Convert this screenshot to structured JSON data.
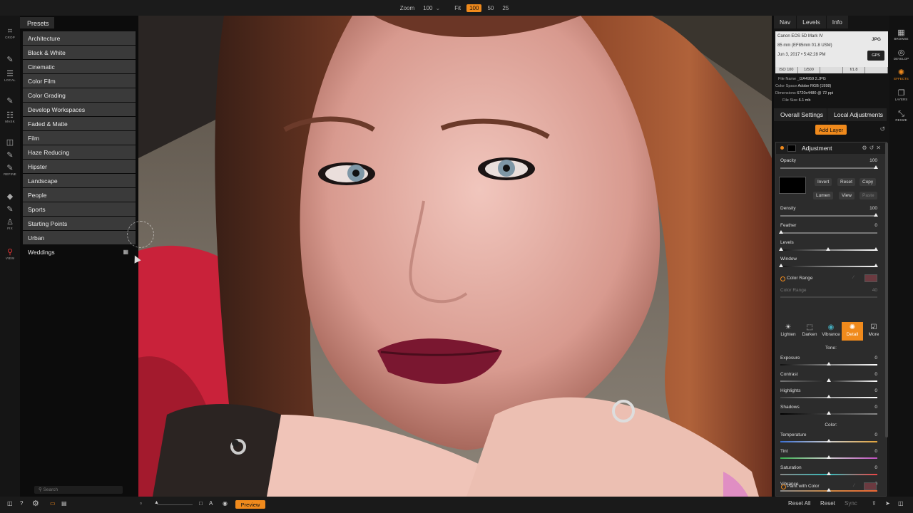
{
  "topbar": {
    "zoom_label": "Zoom",
    "zoom_value": "100",
    "zoom_buttons": [
      "Fit",
      "100",
      "50",
      "25"
    ],
    "active_zoom": "100"
  },
  "tools_left": [
    {
      "icon": "crop-icon",
      "label": "CROP"
    },
    {
      "icon": "brush-icon",
      "label": ""
    },
    {
      "icon": "local-icon",
      "label": "LOCAL"
    },
    {
      "icon": "mask-brush-icon",
      "label": ""
    },
    {
      "icon": "mask-icon",
      "label": "MASK"
    },
    {
      "icon": "refine-icon",
      "label": ""
    },
    {
      "icon": "refine-brush-icon",
      "label": ""
    },
    {
      "icon": "refine-pen-icon",
      "label": "REFINE"
    },
    {
      "icon": "fix-drop-icon",
      "label": ""
    },
    {
      "icon": "fix-pen-icon",
      "label": ""
    },
    {
      "icon": "fix-stamp-icon",
      "label": "FIX"
    },
    {
      "icon": "view-zoom-icon",
      "label": "VIEW"
    }
  ],
  "presets": {
    "header": "Presets",
    "items": [
      "Architecture",
      "Black & White",
      "Cinematic",
      "Color Film",
      "Color Grading",
      "Develop Workspaces",
      "Faded & Matte",
      "Film",
      "Haze Reducing",
      "Hipster",
      "Landscape",
      "People",
      "Sports",
      "Starting Points",
      "Urban",
      "Weddings"
    ],
    "search_placeholder": "Search"
  },
  "right_panel": {
    "tabs": [
      "Nav",
      "Levels",
      "Info"
    ],
    "info": {
      "camera": "Canon EOS 5D Mark IV",
      "lens": "85 mm (EF85mm f/1.8 USM)",
      "date": "Jun 3, 2017 • 5:42:28 PM",
      "format": "JPG",
      "gps": "GPS",
      "exposure": [
        "ISO 100",
        "1/500",
        "",
        "f/1.8",
        ""
      ]
    },
    "file": {
      "name_key": "File Name",
      "name": "_I2A4959 2.JPG",
      "space_key": "Color Space",
      "space": "Adobe RGB (1998)",
      "dims_key": "Dimensions",
      "dims": "6720x4480 @ 72 ppi",
      "size_key": "File Size",
      "size": "6.1 mb"
    },
    "settings_tabs": [
      "Overall Settings",
      "Local Adjustments"
    ],
    "add_layer": "Add Layer",
    "adjustment": {
      "title": "Adjustment",
      "opacity_label": "Opacity",
      "opacity": "100",
      "buttons_row1": [
        "Invert",
        "Reset",
        "Copy"
      ],
      "buttons_row2": [
        "Lumen",
        "View",
        "Paste"
      ],
      "density_label": "Density",
      "density": "100",
      "feather_label": "Feather",
      "feather": "0",
      "levels_label": "Levels",
      "window_label": "Window",
      "color_range_label": "Color Range",
      "color_range_sub": "Color Range",
      "color_range_value": "40",
      "fx_buttons": [
        {
          "icon": "lighten-icon",
          "label": "Lighten"
        },
        {
          "icon": "darken-icon",
          "label": "Darken"
        },
        {
          "icon": "vibrance-icon",
          "label": "Vibrance"
        },
        {
          "icon": "detail-icon",
          "label": "Detail"
        },
        {
          "icon": "more-icon",
          "label": "More"
        }
      ],
      "active_fx": "Detail",
      "tone_title": "Tone:",
      "tone": [
        {
          "label": "Exposure",
          "value": "0"
        },
        {
          "label": "Contrast",
          "value": "0"
        },
        {
          "label": "Highlights",
          "value": "0"
        },
        {
          "label": "Shadows",
          "value": "0"
        }
      ],
      "color_title": "Color:",
      "color": [
        {
          "label": "Temperature",
          "value": "0"
        },
        {
          "label": "Tint",
          "value": "0"
        },
        {
          "label": "Saturation",
          "value": "0"
        },
        {
          "label": "Vibrance",
          "value": "0"
        }
      ],
      "paint_label": "Paint with Color"
    }
  },
  "tools_right": [
    {
      "icon": "browse-icon",
      "label": "BROWSE"
    },
    {
      "icon": "develop-icon",
      "label": "DEVELOP"
    },
    {
      "icon": "effects-icon",
      "label": "EFFECTS"
    },
    {
      "icon": "layers-icon",
      "label": "LAYERS"
    },
    {
      "icon": "resize-icon",
      "label": "RESIZE"
    }
  ],
  "active_right_tool": "EFFECTS",
  "bottom": {
    "preview": "Preview",
    "reset_all": "Reset All",
    "reset": "Reset",
    "sync": "Sync"
  },
  "colors": {
    "accent": "#f08a1c",
    "panel": "#2c2c2c",
    "preset_item": "#3a3a3a"
  }
}
